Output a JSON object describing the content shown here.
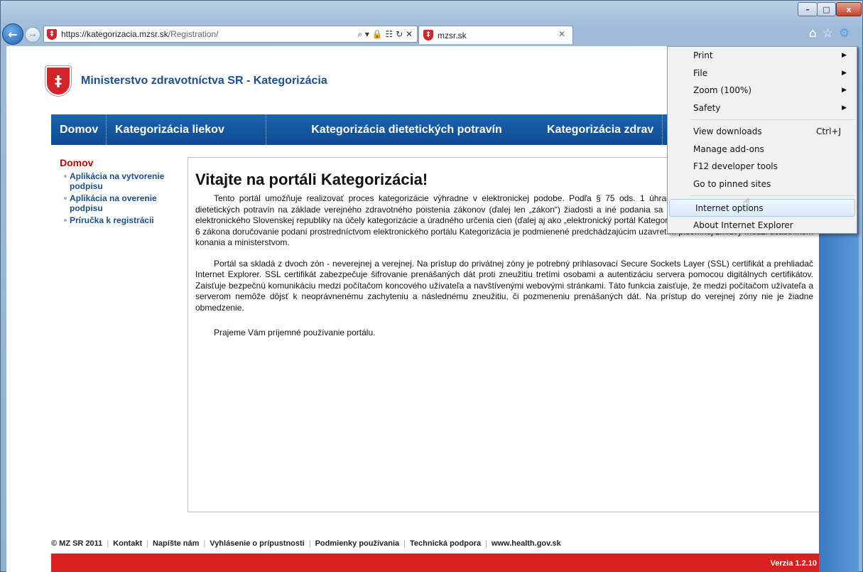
{
  "window": {
    "minimize_label": "–",
    "maximize_label": "□",
    "close_label": "x"
  },
  "browser": {
    "url_host": "https://kategorizacia.mzsr.sk",
    "url_path": "/Registration/",
    "address_tools": "⌕ ▾ 🔒 ☷ ↻ ✕",
    "tab_title": "mzsr.sk",
    "tab_close": "✕",
    "home_icon": "⌂",
    "favorites_icon": "☆",
    "tools_icon": "⚙"
  },
  "site": {
    "title": "Ministerstvo zdravotníctva SR - Kategorizácia",
    "coat_symbol": "‡"
  },
  "menu": {
    "home": "Domov",
    "drugs": "Kategorizácia liekov",
    "food": "Kategorizácia dietetických potravín",
    "other": "Kategorizácia zdrav"
  },
  "leftnav": {
    "title": "Domov",
    "items": [
      "Aplikácia na vytvorenie podpisu",
      "Aplikácia na overenie podpisu",
      "Príručka k registrácii"
    ]
  },
  "content": {
    "heading": "Vitajte na portáli Kategorizácia!",
    "p1": "Tento portál umožňuje realizovať proces kategorizácie výhradne v elektronickej podobe. Podľa § 75 ods. 1 úhrady liekov, zdravotníckych pomôcok a dietetických potravín na základe verejného zdravotného poistenia zákonov (ďalej len „zákon“) žiadosti a iné podania sa ministerstvu doručujú prostredníctvom elektronického Slovenskej republiky na účely kategorizácie a úradného určenia cien (ďalej aj ako „elektronický portál Kategorizácia“ alebo „portál“). Podľa § 75 ods. 6 zákona doručovanie podaní prostredníctvom elektronického portálu Kategorizácia je podmienené predchádzajúcim uzavretím písomnej zmluvy medzi účastníkom konania a ministerstvom.",
    "p2": "Portál sa skladá z dvoch zón - neverejnej a verejnej. Na prístup do privátnej zóny je potrebný prihlasovací Secure Sockets Layer (SSL) certifikát a prehliadač Internet Explorer. SSL certifikát zabezpečuje šifrovanie prenášaných dát proti zneužitiu tretími osobami a autentizáciu servera pomocou digitálnych certifikátov. Zaisťuje bezpečnú komunikáciu medzi počítačom koncového užívateľa a navštívenými webovými stránkami. Táto funkcia zaisťuje, že medzi počítačom užívateľa a serverom nemôže dôjsť k neoprávnenému zachyteniu a následnému zneužitiu, či pozmeneniu prenášaných dát. Na prístup do verejnej zóny nie je žiadne obmedzenie.",
    "p3": "Prajeme Vám príjemné používanie portálu."
  },
  "footer": {
    "copyright": "© MZ SR 2011",
    "links": [
      "Kontakt",
      "Napíšte nám",
      "Vyhlásenie o prípustnosti",
      "Podmienky používania",
      "Technická podpora",
      "www.health.gov.sk"
    ],
    "version": "Verzia 1.2.10"
  },
  "tools_menu": {
    "print": "Print",
    "file": "File",
    "zoom": "Zoom (100%)",
    "safety": "Safety",
    "view_downloads": "View downloads",
    "view_downloads_shortcut": "Ctrl+J",
    "manage_addons": "Manage add-ons",
    "f12": "F12 developer tools",
    "pinned": "Go to pinned sites",
    "internet_options": "Internet options",
    "about": "About Internet Explorer",
    "submenu_arrow": "▶"
  }
}
